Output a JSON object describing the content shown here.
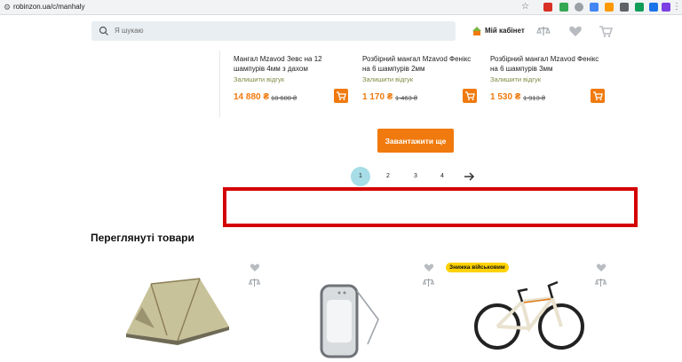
{
  "browser": {
    "url": "robinzon.ua/c/manhaly"
  },
  "header": {
    "search_placeholder": "Я шукаю",
    "cabinet_label": "Мій кабінет"
  },
  "products": [
    {
      "title": "Мангал Mzavod Зевс на 12 шампурів 4мм з дахом",
      "review": "Залишити відгук",
      "price": "14 880 ₴",
      "old_price": "18 600 ₴"
    },
    {
      "title": "Розбірний мангал Mzavod Фенікс на 6 шампурів 2мм",
      "review": "Залишити відгук",
      "price": "1 170 ₴",
      "old_price": "1 463 ₴"
    },
    {
      "title": "Розбірний мангал Mzavod Фенікс на 6 шампурів 3мм",
      "review": "Залишити відгук",
      "price": "1 530 ₴",
      "old_price": "1 913 ₴"
    }
  ],
  "load_more_label": "Завантажити ще",
  "pagination": {
    "pages": [
      "1",
      "2",
      "3",
      "4"
    ],
    "current": "1"
  },
  "viewed": {
    "title": "Переглянуті товари",
    "items": [
      {
        "image": "tent"
      },
      {
        "image": "lantern"
      },
      {
        "image": "bicycle",
        "badge": "Знижка військовим"
      }
    ]
  },
  "colors": {
    "accent": "#f07a0d",
    "review_green": "#7c8b43",
    "pagination_active": "#a7dde6",
    "ad_border": "#d40000",
    "badge": "#ffd200"
  }
}
